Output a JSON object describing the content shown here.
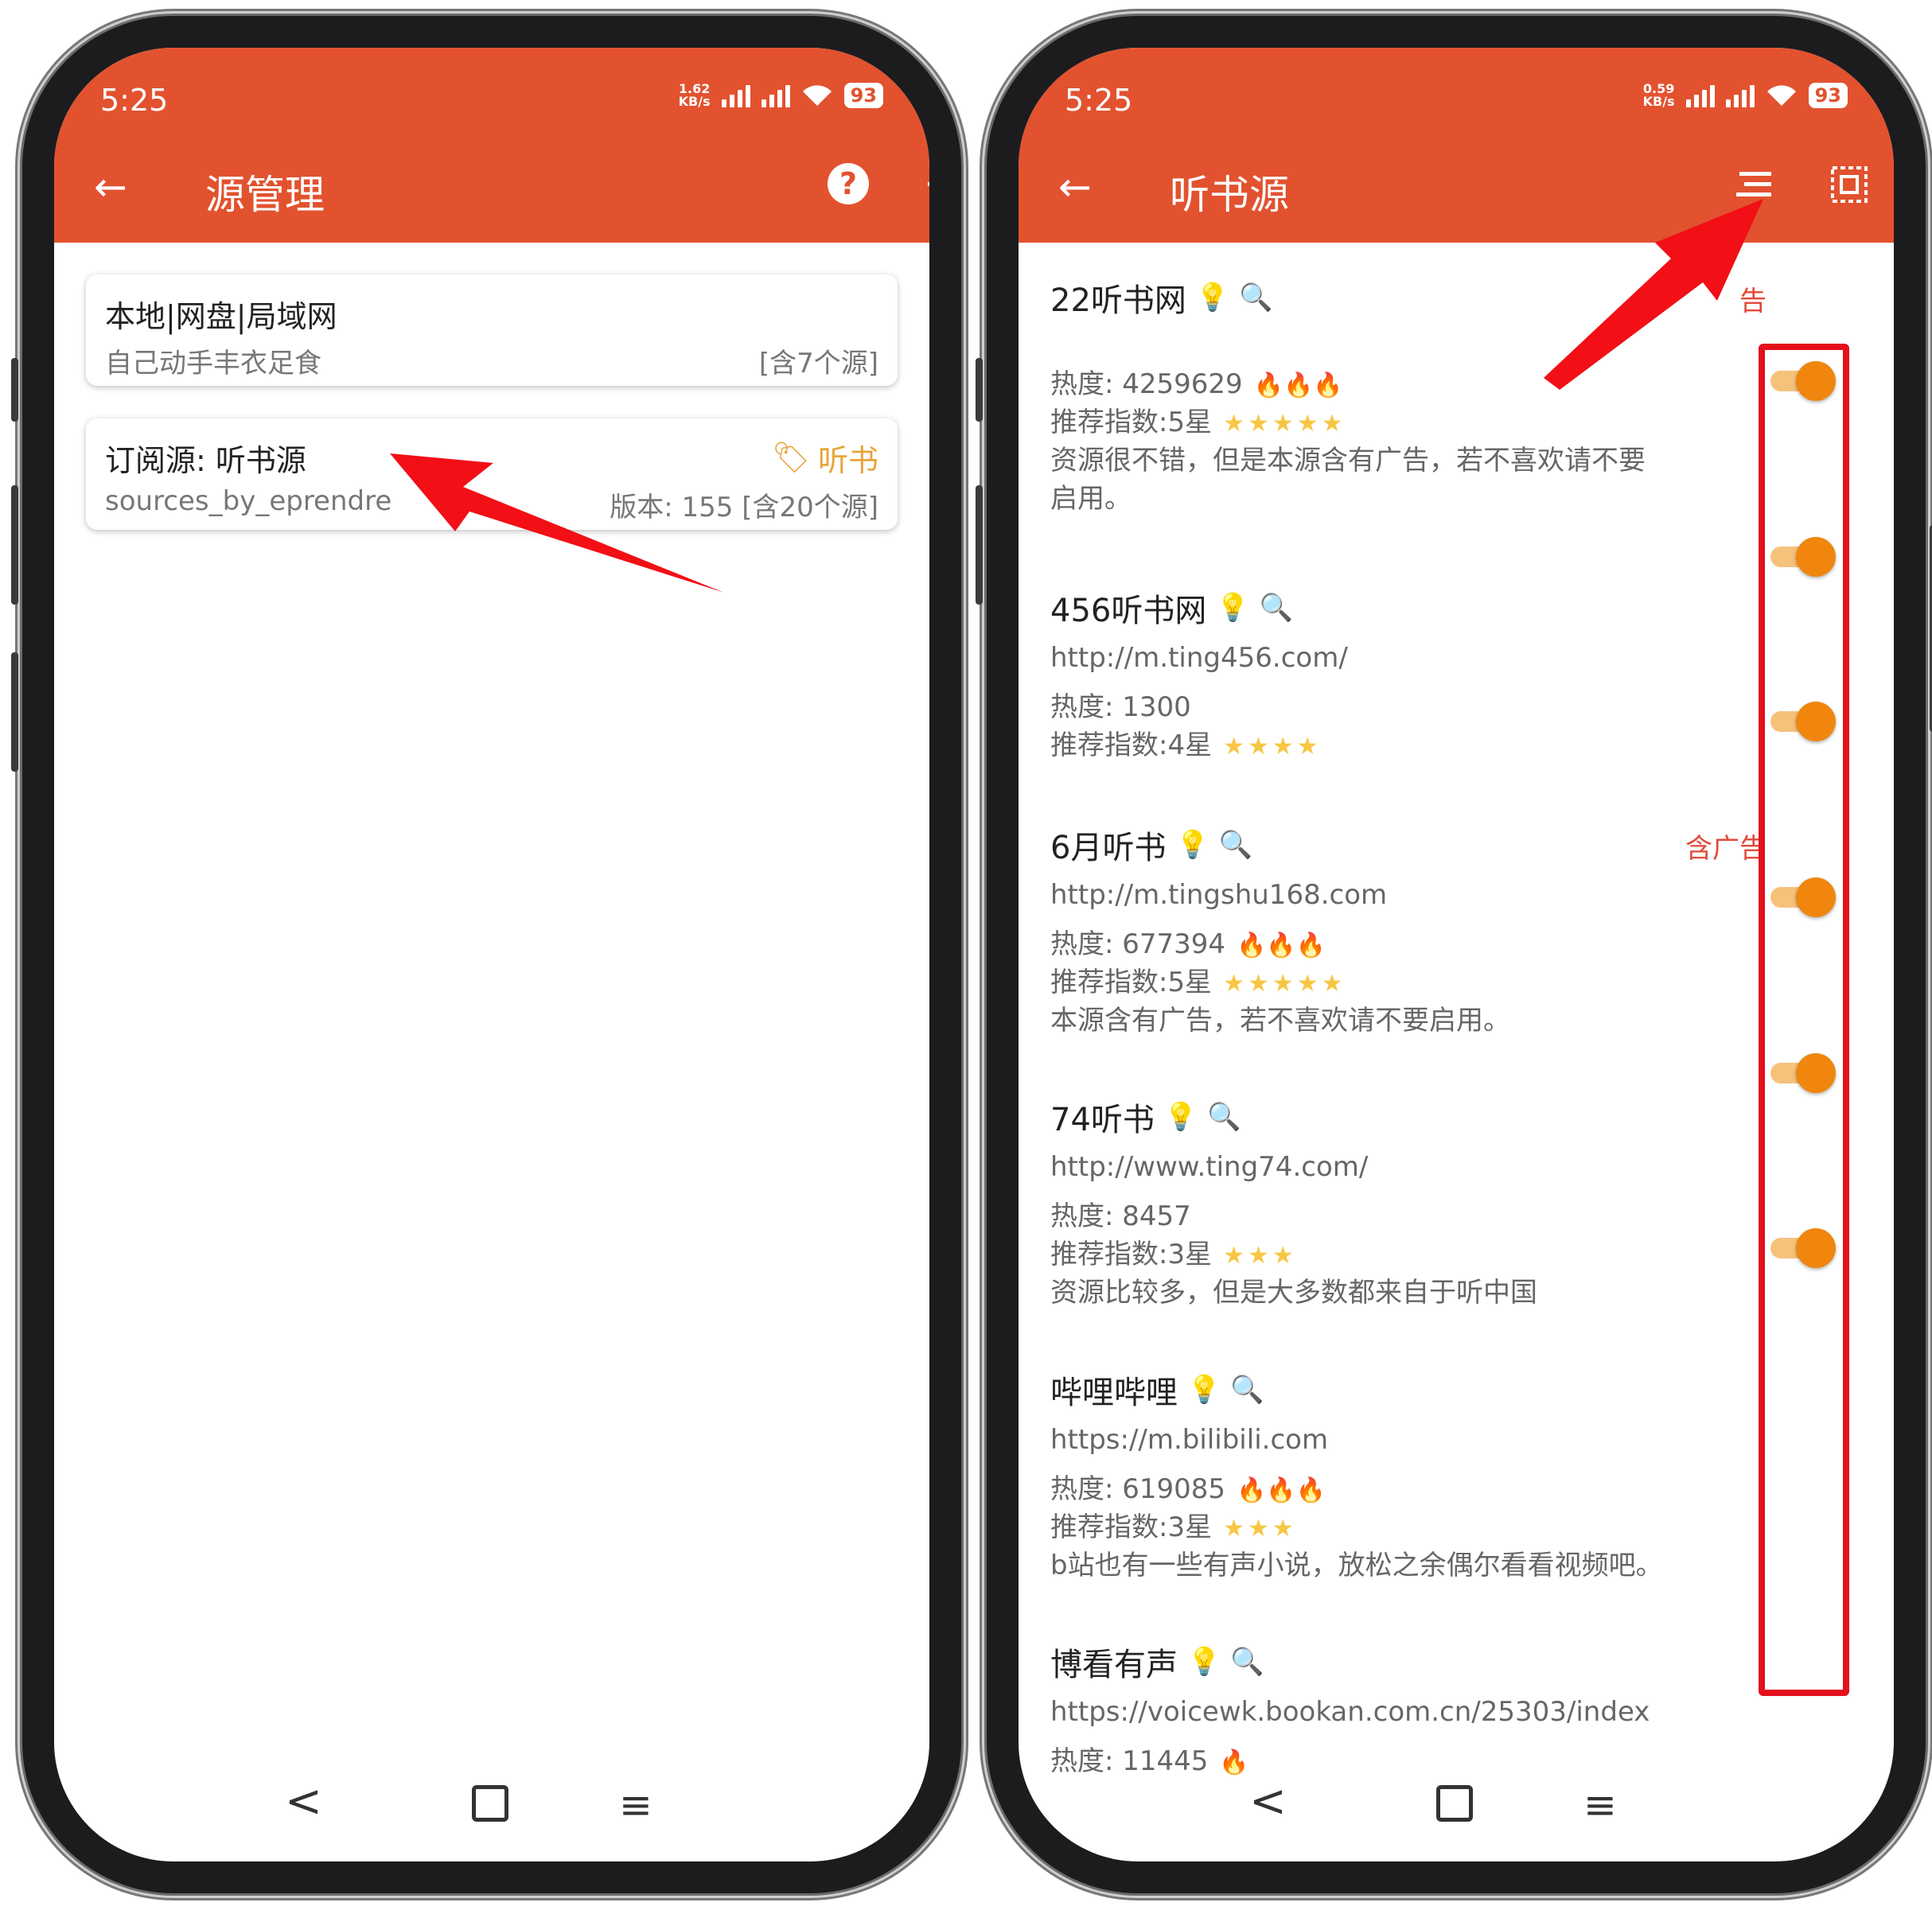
{
  "left_phone": {
    "status": {
      "time": "5:25",
      "speed_value": "1.62",
      "speed_unit": "KB/s",
      "battery": "93"
    },
    "toolbar": {
      "back_icon": "arrow-left-icon",
      "title": "源管理",
      "help_icon": "help-icon",
      "add_icon": "plus-icon"
    },
    "cards": [
      {
        "title": "本地|网盘|局域网",
        "subtitle": "自己动手丰衣足食",
        "right_text": "[含7个源]"
      },
      {
        "title": "订阅源: 听书源",
        "subtitle": "sources_by_eprendre",
        "tag": "听书",
        "tag_icon": "label-icon",
        "right_text": "版本: 155 [含20个源]"
      }
    ],
    "nav": {
      "back": "<",
      "home": "home-icon",
      "menu": "≡"
    }
  },
  "right_phone": {
    "status": {
      "time": "5:25",
      "speed_value": "0.59",
      "speed_unit": "KB/s",
      "battery": "93"
    },
    "toolbar": {
      "back_icon": "arrow-left-icon",
      "title": "听书源",
      "sort_icon": "sort-icon",
      "select_icon": "select-all-icon"
    },
    "items": [
      {
        "title": "22听书网",
        "ad_tag": "告",
        "lines": [
          "热度: 4259629",
          "推荐指数:5星",
          "资源很不错，但是本源含有广告，若不喜欢请不要",
          "启用。"
        ],
        "flames": "🔥🔥🔥",
        "stars": "★★★★★",
        "enabled": true
      },
      {
        "title": "456听书网",
        "lines": [
          "http://m.ting456.com/",
          "热度: 1300",
          "推荐指数:4星"
        ],
        "stars": "★★★★",
        "enabled": true
      },
      {
        "title": "6月听书",
        "ad_tag": "含广告",
        "lines": [
          "http://m.tingshu168.com",
          "热度: 677394",
          "推荐指数:5星",
          "本源含有广告，若不喜欢请不要启用。"
        ],
        "flames": "🔥🔥🔥",
        "stars": "★★★★★",
        "enabled": true
      },
      {
        "title": "74听书",
        "lines": [
          "http://www.ting74.com/",
          "热度: 8457",
          "推荐指数:3星",
          "资源比较多，但是大多数都来自于听中国"
        ],
        "stars": "★★★",
        "enabled": true
      },
      {
        "title": "哔哩哔哩",
        "lines": [
          "https://m.bilibili.com",
          "热度: 619085",
          "推荐指数:3星",
          " b站也有一些有声小说，放松之余偶尔看看视频吧。"
        ],
        "flames": "🔥🔥🔥",
        "stars": "★★★",
        "enabled": true
      },
      {
        "title": "博看有声",
        "lines": [
          "https://voicewk.bookan.com.cn/25303/index",
          "热度: 11445"
        ],
        "flames": "🔥",
        "enabled": true
      }
    ],
    "item_icons": {
      "bulb": "💡",
      "search": "🔍"
    },
    "nav": {
      "back": "<",
      "home": "home-icon",
      "menu": "≡"
    }
  },
  "colors": {
    "appbar": "#e2522f",
    "toggle_on": "#f0860e",
    "annotation_red": "#e4101c",
    "tag_orange": "#e8a33a"
  }
}
